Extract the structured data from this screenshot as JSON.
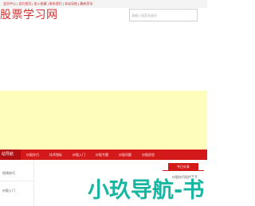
{
  "topbar": {
    "notice": "会员中心 | 设为首页 | 加入收藏 | 联系我们 | 本站导航 | 最新资讯"
  },
  "header": {
    "site_title": "股票学习网",
    "search_placeholder": "请输入搜索关键词"
  },
  "nav": {
    "brand": "站导航",
    "items": [
      "炒股技巧",
      "技术指标",
      "炒股入门",
      "炒股专题",
      "炒股问题",
      "炒股经验"
    ]
  },
  "sidebar": {
    "items": [
      "短线技巧",
      "炒股入门"
    ]
  },
  "hot": {
    "tab_label": "今日头条",
    "item": "炒股技巧短线高手"
  },
  "watermark": {
    "text": "小玖导航-书"
  },
  "colors": {
    "brand_red": "#d4191b",
    "banner_yellow": "#fffdbb"
  }
}
